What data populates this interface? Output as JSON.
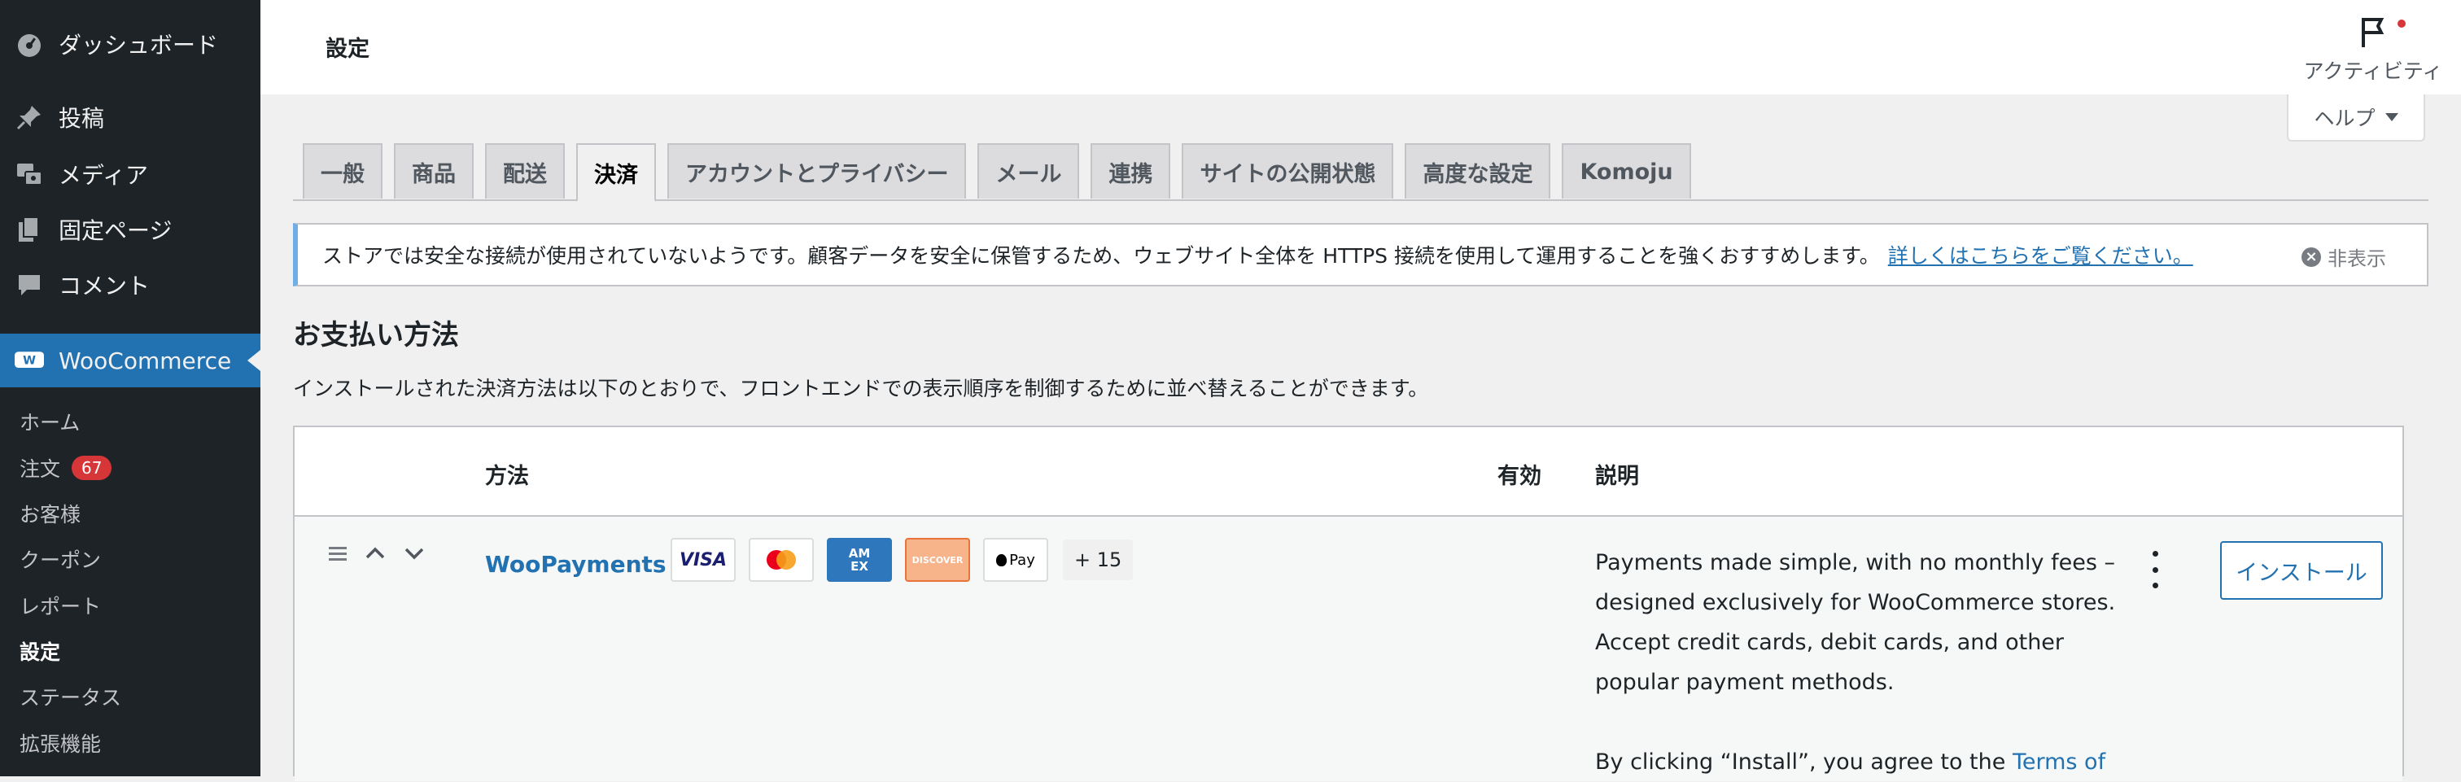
{
  "sidebar": {
    "dashboard_label": "ダッシュボード",
    "posts_label": "投稿",
    "media_label": "メディア",
    "pages_label": "固定ページ",
    "comments_label": "コメント",
    "woocommerce_label": "WooCommerce",
    "submenu": {
      "home": "ホーム",
      "orders": "注文",
      "orders_count": "67",
      "customers": "お客様",
      "coupons": "クーポン",
      "reports": "レポート",
      "settings": "設定",
      "status": "ステータス",
      "extensions": "拡張機能"
    },
    "colors": {
      "background": "#1d2327",
      "accent": "#2271b1",
      "badge": "#d63638"
    }
  },
  "header": {
    "title": "設定",
    "activity_label": "アクティビティ",
    "help_label": "ヘルプ"
  },
  "tabs": [
    {
      "label": "一般",
      "active": false
    },
    {
      "label": "商品",
      "active": false
    },
    {
      "label": "配送",
      "active": false
    },
    {
      "label": "決済",
      "active": true
    },
    {
      "label": "アカウントとプライバシー",
      "active": false
    },
    {
      "label": "メール",
      "active": false
    },
    {
      "label": "連携",
      "active": false
    },
    {
      "label": "サイトの公開状態",
      "active": false
    },
    {
      "label": "高度な設定",
      "active": false
    },
    {
      "label": "Komoju",
      "active": false
    }
  ],
  "notice": {
    "message": "ストアでは安全な接続が使用されていないようです。顧客データを安全に保管するため、ウェブサイト全体を HTTPS 接続を使用して運用することを強くおすすめします。",
    "link": "詳しくはこちらをご覧ください。",
    "dismiss": "非表示"
  },
  "section": {
    "title": "お支払い方法",
    "description": "インストールされた決済方法は以下のとおりで、フロントエンドでの表示順序を制御するために並べ替えることができます。"
  },
  "table": {
    "headers": {
      "method": "方法",
      "enabled": "有効",
      "description": "説明"
    },
    "row": {
      "name": "WooPayments",
      "cards": {
        "visa": "VISA",
        "amex": "AM EX",
        "discover": "DISCOVER",
        "applepay": "Pay"
      },
      "more_methods": "+ 15",
      "description_p1": "Payments made simple, with no monthly fees – designed exclusively for WooCommerce stores. Accept credit cards, debit cards, and other popular payment methods.",
      "description_p2": "By clicking “Install”, you agree to the",
      "description_link": "Terms of",
      "install_label": "インストール"
    }
  }
}
